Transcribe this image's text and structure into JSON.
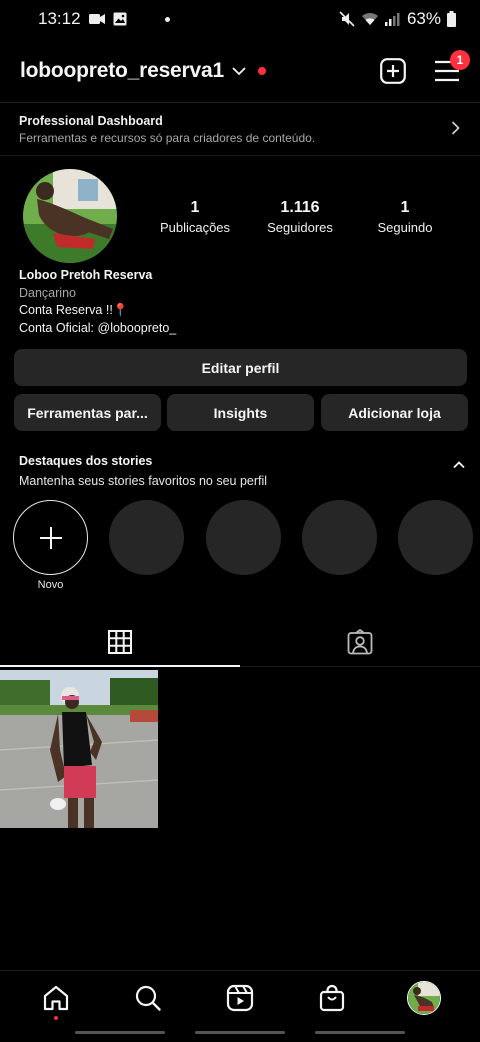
{
  "status_bar": {
    "time": "13:12",
    "battery": "63%",
    "icons": [
      "video-camera-icon",
      "gallery-icon",
      "mute-icon",
      "wifi-icon",
      "signal-icon",
      "battery-icon"
    ]
  },
  "header": {
    "username": "loboopreto_reserva1",
    "notification_count": "1",
    "icons": [
      "chevron-down-icon",
      "create-post-icon",
      "menu-icon"
    ]
  },
  "dashboard": {
    "title": "Professional Dashboard",
    "subtitle": "Ferramentas e recursos só para criadores de conteúdo."
  },
  "profile": {
    "stats": [
      {
        "value": "1",
        "label": "Publicações"
      },
      {
        "value": "1.116",
        "label": "Seguidores"
      },
      {
        "value": "1",
        "label": "Seguindo"
      }
    ],
    "name": "Loboo Pretoh Reserva",
    "category": "Dançarino",
    "bio_line1": "Conta Reserva !!📍",
    "bio_line2": "Conta Oficial: @loboopreto_"
  },
  "buttons": {
    "edit_profile": "Editar perfil",
    "tools": "Ferramentas par...",
    "insights": "Insights",
    "add_shop": "Adicionar loja"
  },
  "highlights": {
    "title": "Destaques dos stories",
    "subtitle": "Mantenha seus stories favoritos no seu perfil",
    "new_label": "Novo"
  },
  "colors": {
    "background": "#000000",
    "button": "#262626",
    "accent_red": "#ff3040",
    "secondary_text": "#a8a8a8"
  }
}
